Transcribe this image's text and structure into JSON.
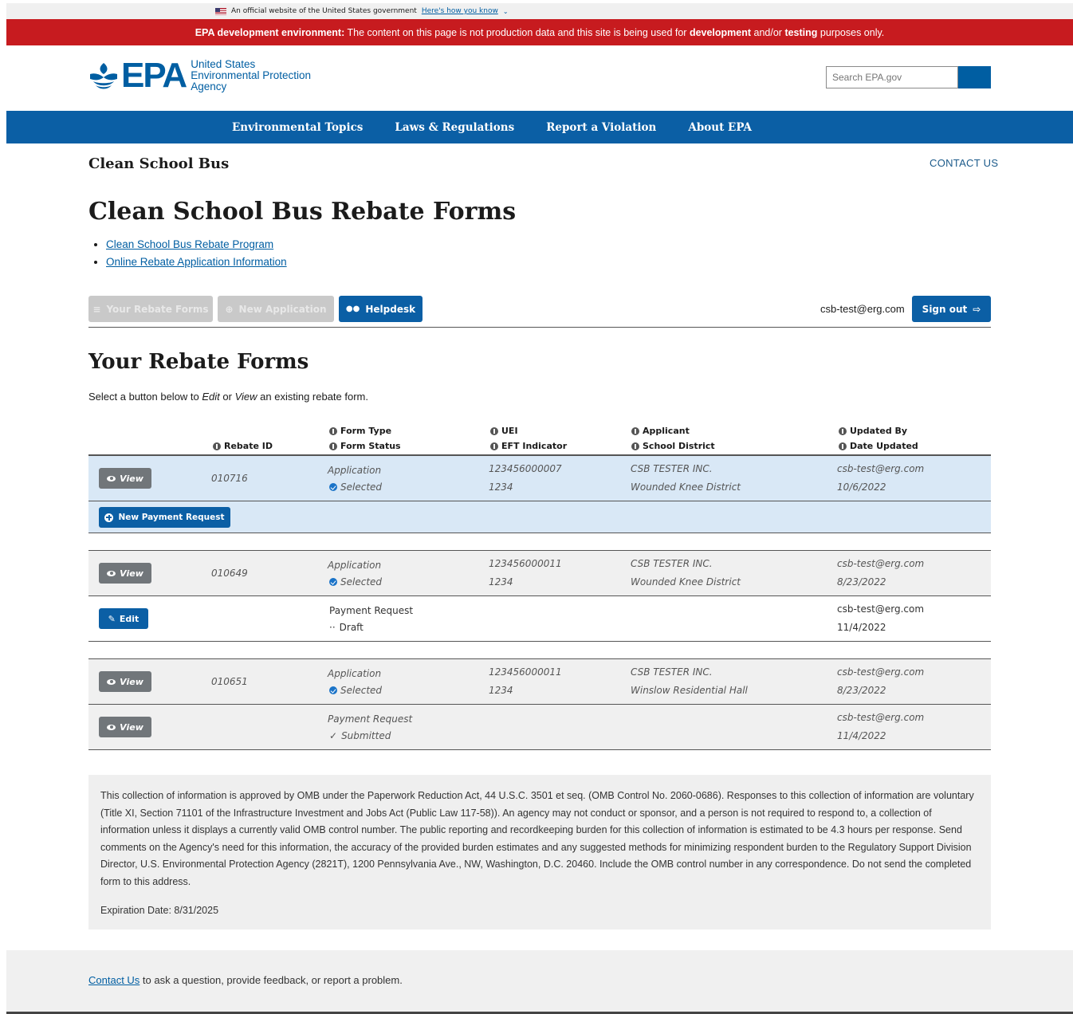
{
  "gov_banner": {
    "text": "An official website of the United States government",
    "link": "Here's how you know"
  },
  "dev_banner": {
    "bold1": "EPA development environment:",
    "text1": " The content on this page is not production data and this site is being used for ",
    "bold2": "development",
    "text2": " and/or ",
    "bold3": "testing",
    "text3": " purposes only."
  },
  "logo": {
    "wordmark": "EPA",
    "line1": "United States",
    "line2": "Environmental Protection",
    "line3": "Agency"
  },
  "search": {
    "placeholder": "Search EPA.gov"
  },
  "nav": [
    "Environmental Topics",
    "Laws & Regulations",
    "Report a Violation",
    "About EPA"
  ],
  "site_title": "Clean School Bus",
  "contact_us": "CONTACT US",
  "page_title": "Clean School Bus Rebate Forms",
  "links": [
    "Clean School Bus Rebate Program",
    "Online Rebate Application Information"
  ],
  "toolbar": {
    "your_forms": "Your Rebate Forms",
    "new_application": "New Application",
    "helpdesk": "Helpdesk",
    "user_email": "csb-test@erg.com",
    "sign_out": "Sign out"
  },
  "section_title": "Your Rebate Forms",
  "intro": {
    "pre": "Select a button below to ",
    "edit": "Edit",
    "mid": " or ",
    "view": "View",
    "post": " an existing rebate form."
  },
  "table": {
    "headers": {
      "rebate_id": "Rebate ID",
      "form_type": "Form Type",
      "form_status": "Form Status",
      "uei": "UEI",
      "eft": "EFT Indicator",
      "applicant": "Applicant",
      "district": "School District",
      "updated_by": "Updated By",
      "date_updated": "Date Updated"
    },
    "view_label": "View",
    "edit_label": "Edit",
    "new_payment_label": "New Payment Request",
    "rows": [
      {
        "id": "010716",
        "type": "Application",
        "status": "Selected",
        "uei": "123456000007",
        "eft": "1234",
        "applicant": "CSB TESTER INC.",
        "district": "Wounded Knee District",
        "updated_by": "csb-test@erg.com",
        "date": "10/6/2022"
      },
      {
        "id": "010649",
        "type": "Application",
        "status": "Selected",
        "uei": "123456000011",
        "eft": "1234",
        "applicant": "CSB TESTER INC.",
        "district": "Wounded Knee District",
        "updated_by": "csb-test@erg.com",
        "date": "8/23/2022"
      },
      {
        "type": "Payment Request",
        "status": "Draft",
        "updated_by": "csb-test@erg.com",
        "date": "11/4/2022"
      },
      {
        "id": "010651",
        "type": "Application",
        "status": "Selected",
        "uei": "123456000011",
        "eft": "1234",
        "applicant": "CSB TESTER INC.",
        "district": "Winslow Residential Hall",
        "updated_by": "csb-test@erg.com",
        "date": "8/23/2022"
      },
      {
        "type": "Payment Request",
        "status": "Submitted",
        "updated_by": "csb-test@erg.com",
        "date": "11/4/2022"
      }
    ]
  },
  "omb": {
    "text": "This collection of information is approved by OMB under the Paperwork Reduction Act, 44 U.S.C. 3501 et seq. (OMB Control No. 2060-0686). Responses to this collection of information are voluntary (Title XI, Section 71101 of the Infrastructure Investment and Jobs Act (Public Law 117-58)). An agency may not conduct or sponsor, and a person is not required to respond to, a collection of information unless it displays a currently valid OMB control number. The public reporting and recordkeeping burden for this collection of information is estimated to be 4.3 hours per response. Send comments on the Agency's need for this information, the accuracy of the provided burden estimates and any suggested methods for minimizing respondent burden to the Regulatory Support Division Director, U.S. Environmental Protection Agency (2821T), 1200 Pennsylvania Ave., NW, Washington, D.C. 20460. Include the OMB control number in any correspondence. Do not send the completed form to this address.",
    "expiration": "Expiration Date: 8/31/2025"
  },
  "footer": {
    "link": "Contact Us",
    "text": " to ask a question, provide feedback, or report a problem."
  },
  "colors": {
    "dev_banner": "#c71b1f",
    "nav": "#0b5fa5",
    "primary": "#005ea2",
    "row_highlight": "#d9e8f6"
  }
}
